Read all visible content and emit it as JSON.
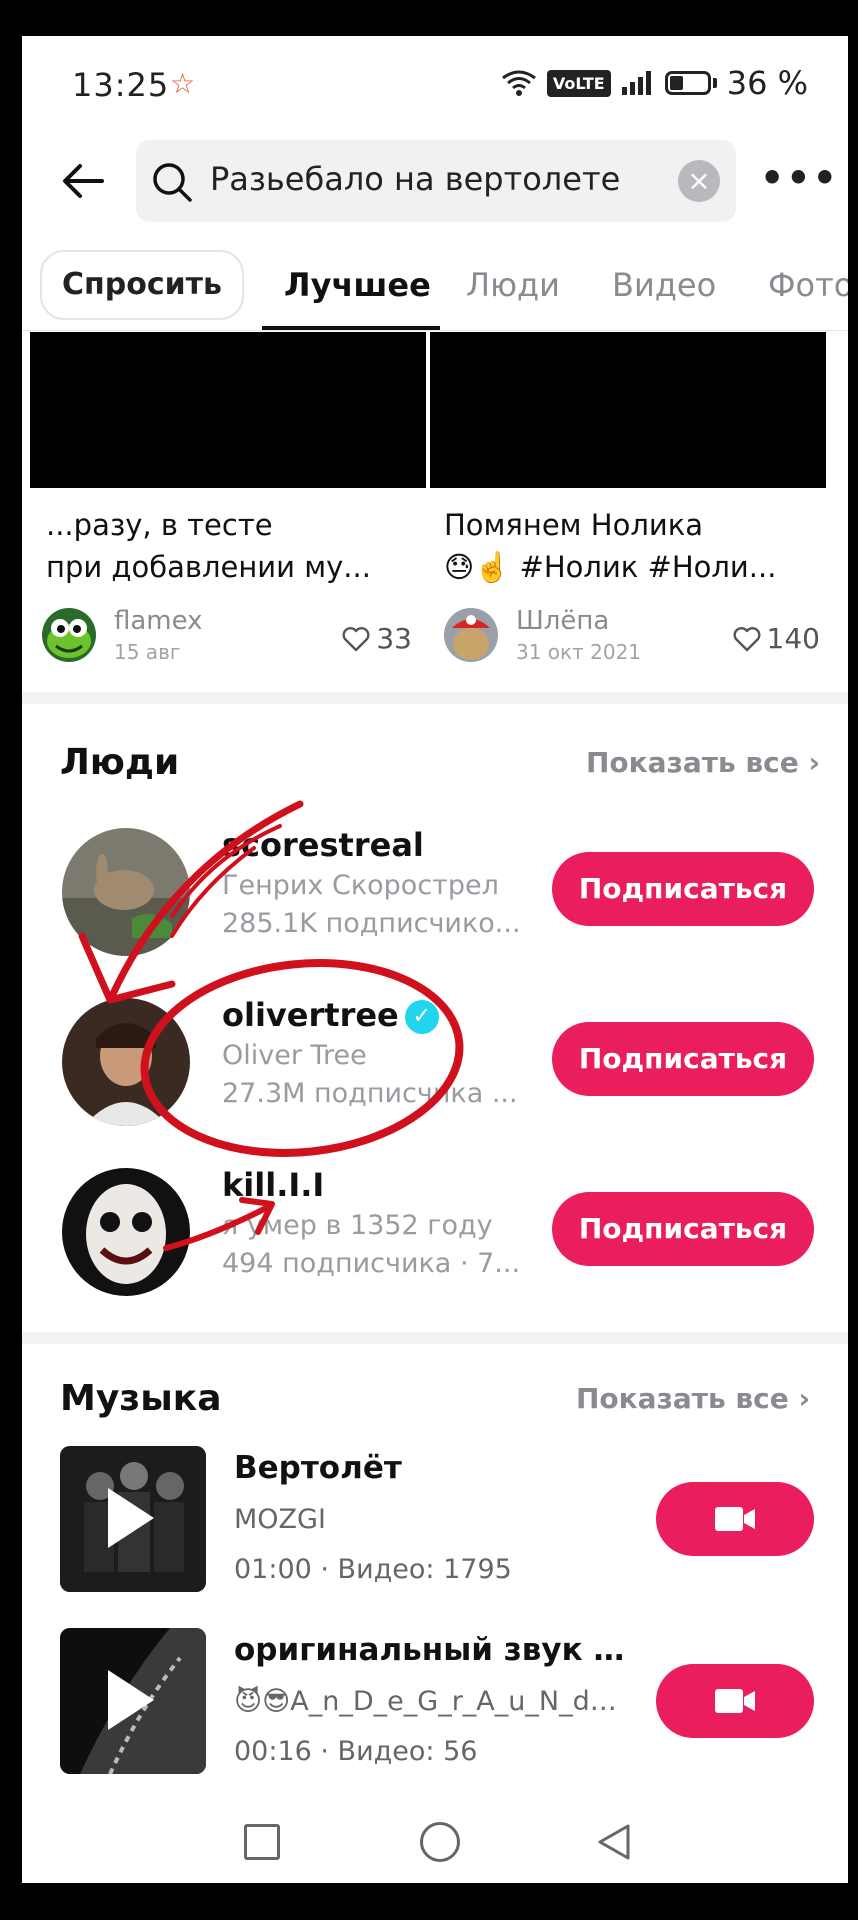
{
  "status_bar": {
    "time": "13:25",
    "battery": "36 %",
    "volte": "VoLTE"
  },
  "search": {
    "query": "Разьебало на вертолете"
  },
  "tabs": {
    "ask": "Спросить",
    "items": [
      "Лучшее",
      "Люди",
      "Видео",
      "Фото"
    ]
  },
  "videos": [
    {
      "title_line1": "...разу, в тесте",
      "title_line2": "при добавлении му...",
      "author": "flamex",
      "date": "15 авг",
      "likes": "33"
    },
    {
      "title_line1": "Помянем Нолика",
      "title_line2": "😓☝️ #Нолик #Ноли...",
      "author": "Шлёпа",
      "date": "31 окт 2021",
      "likes": "140"
    }
  ],
  "people": {
    "title": "Люди",
    "show_all": "Показать все",
    "users": [
      {
        "username": "scorestreal",
        "name": "Генрих Скорострел",
        "followers": "285.1K подписчико...",
        "button": "Подписаться"
      },
      {
        "username": "olivertree",
        "name": "Oliver Tree",
        "followers": "27.3M подписчика ...",
        "button": "Подписаться",
        "verified": true
      },
      {
        "username": "kill.I.I",
        "name": "я умер в 1352 году",
        "followers": "494 подписчика · 7...",
        "button": "Подписаться"
      }
    ]
  },
  "music": {
    "title": "Музыка",
    "show_all": "Показать все",
    "tracks": [
      {
        "title": "Вертолёт",
        "artist": "MOZGI",
        "meta": "01:00 · Видео: 1795"
      },
      {
        "title": "оригинальный звук -...",
        "artist": "😈😎A_n_D_e_G_r_A_u_N_d😎...",
        "meta": "00:16 · Видео: 56"
      }
    ]
  },
  "colors": {
    "accent": "#ea1d5d",
    "verified": "#20d5ec",
    "annotation": "#d0101c"
  }
}
